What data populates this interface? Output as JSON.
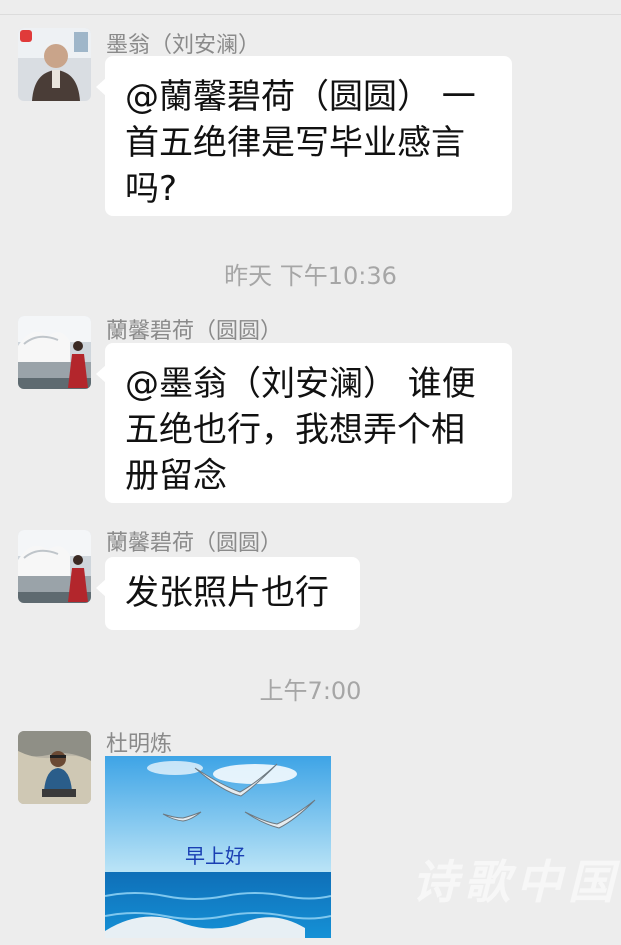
{
  "messages": [
    {
      "sender": "墨翁（刘安澜）",
      "lines": [
        "@蘭馨碧荷（圆圆） 一",
        "首五绝律是写毕业感言",
        "吗?"
      ]
    },
    {
      "sender": "蘭馨碧荷（圆圆）",
      "lines": [
        "@墨翁（刘安澜） 谁便",
        "五绝也行，我想弄个相",
        "册留念"
      ]
    },
    {
      "sender": "蘭馨碧荷（圆圆）",
      "lines": [
        "发张照片也行"
      ]
    },
    {
      "sender": "杜明炼",
      "image_caption": "早上好"
    }
  ],
  "timestamps": [
    "昨天 下午10:36",
    "上午7:00"
  ],
  "watermark": "诗歌中国",
  "colors": {
    "background": "#ededed",
    "bubble": "#ffffff",
    "sender_text": "#8a8a8a",
    "timestamp_text": "#a6a6a6"
  },
  "icons": [
    "avatar-mo-weng",
    "avatar-lan-xin-bi-he",
    "avatar-du-ming-lian"
  ]
}
